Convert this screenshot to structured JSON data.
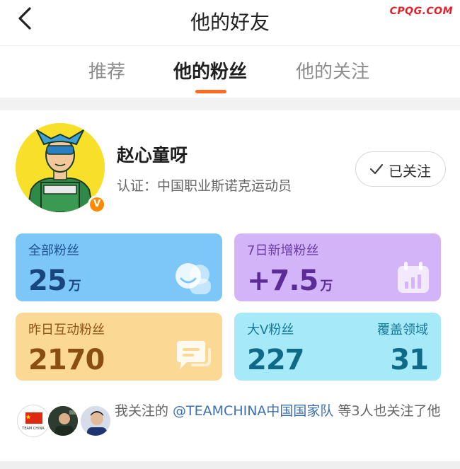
{
  "header": {
    "title": "他的好友",
    "watermark": "CPQG.COM"
  },
  "tabs": [
    {
      "label": "推荐",
      "active": false
    },
    {
      "label": "他的粉丝",
      "active": true
    },
    {
      "label": "他的关注",
      "active": false
    }
  ],
  "profile": {
    "name": "赵心童呀",
    "verification": "认证：中国职业斯诺克运动员",
    "badge": "V",
    "follow_button": "已关注"
  },
  "stats": {
    "total_fans": {
      "label": "全部粉丝",
      "value": "25",
      "unit": "万"
    },
    "new_7d": {
      "label": "7日新增粉丝",
      "value": "+7.5",
      "unit": "万"
    },
    "interactive_yesterday": {
      "label": "昨日互动粉丝",
      "value": "2170"
    },
    "bigv": {
      "label": "大V粉丝",
      "value": "227",
      "coverage_label": "覆盖领域",
      "coverage_value": "31"
    }
  },
  "mutual": {
    "prefix": "我关注的 ",
    "link": "@TEAMCHINA中国国家队",
    "suffix": " 等3人也关注了他",
    "avatar_caption": "TEAM CHINA"
  },
  "colors": {
    "accent": "#ff6a1e",
    "watermark": "#e3202a",
    "card_blue": "#7cc7f8",
    "card_purple": "#d3b4f9",
    "card_yellow": "#fbd994",
    "card_cyan": "#a6e9f9",
    "link": "#3d6fb0"
  },
  "icons": [
    "back-arrow-icon",
    "check-icon",
    "verified-v-icon",
    "fans-group-icon",
    "calendar-chart-icon",
    "chat-bubble-icon"
  ]
}
